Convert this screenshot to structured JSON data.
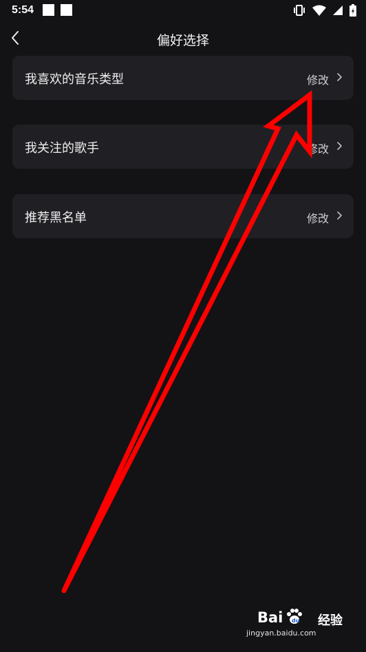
{
  "status_bar": {
    "time": "5:54",
    "icons": [
      "notification-square-icon",
      "notification-square-icon",
      "vibrate-icon",
      "wifi-icon",
      "signal-icon",
      "battery-icon"
    ]
  },
  "header": {
    "title": "偏好选择",
    "back_icon": "chevron-left-icon"
  },
  "preferences": [
    {
      "label": "我喜欢的音乐类型",
      "action": "修改"
    },
    {
      "label": "我关注的歌手",
      "action": "修改"
    },
    {
      "label": "推荐黑名单",
      "action": "修改"
    }
  ],
  "watermark": {
    "brand": "Bai",
    "brand_suffix": "经验",
    "url": "jingyan.baidu.com"
  },
  "colors": {
    "background": "#131316",
    "card": "#202024",
    "annotation": "#ff0000"
  }
}
